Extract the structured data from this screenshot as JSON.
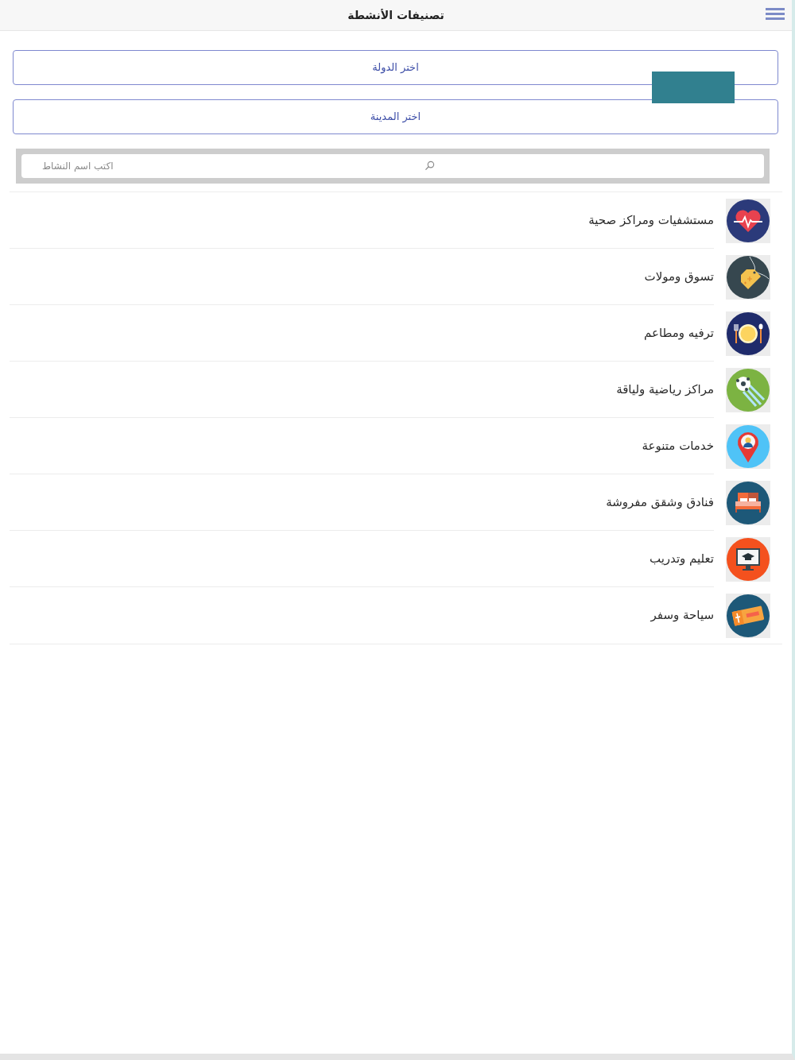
{
  "header": {
    "title": "تصنيفات الأنشطة"
  },
  "selectors": [
    {
      "label": "اختر الدولة"
    },
    {
      "label": "اختر المدينة"
    }
  ],
  "search": {
    "placeholder": "اكتب اسم النشاط"
  },
  "categories": [
    {
      "label": "مستشفيات ومراكز صحية"
    },
    {
      "label": "تسوق ومولات"
    },
    {
      "label": "ترفيه ومطاعم"
    },
    {
      "label": "مراكز رياضية ولياقة"
    },
    {
      "label": "خدمات متنوعة"
    },
    {
      "label": "فنادق وشقق مفروشة"
    },
    {
      "label": "تعليم وتدريب"
    },
    {
      "label": "سياحة وسفر"
    }
  ]
}
